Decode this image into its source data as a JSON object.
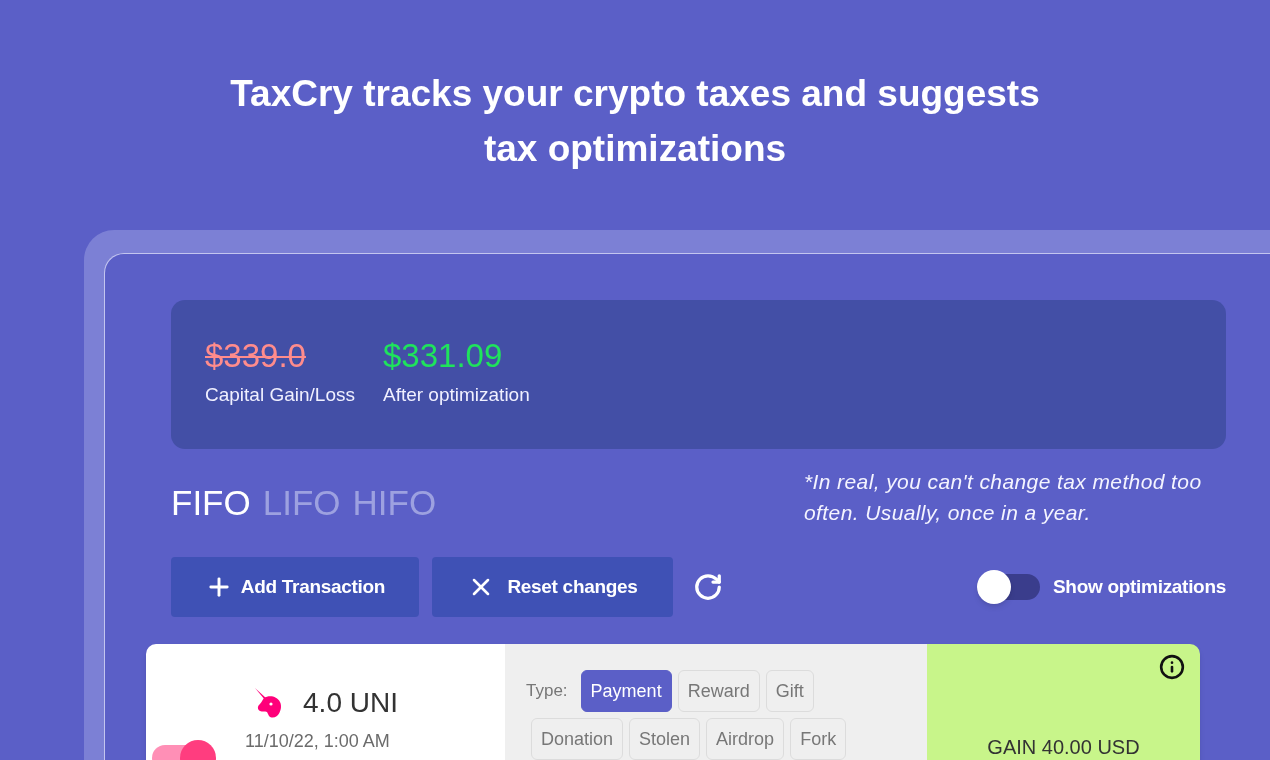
{
  "headline": "TaxCry tracks your crypto taxes and suggests tax optimizations",
  "summary": [
    {
      "kind": "original",
      "value": "$339.0",
      "label": "Capital Gain/Loss"
    },
    {
      "kind": "optimized",
      "value": "$331.09",
      "label": "After optimization"
    }
  ],
  "methods": [
    {
      "label": "FIFO",
      "selected": true
    },
    {
      "label": "LIFO",
      "selected": false
    },
    {
      "label": "HIFO",
      "selected": false
    }
  ],
  "note": "*In real, you can't change tax method too often. Usually, once in a year.",
  "actions": [
    {
      "kind": "add",
      "label": "Add Transaction"
    },
    {
      "kind": "reset",
      "label": "Reset changes"
    },
    {
      "kind": "refresh"
    }
  ],
  "optimizations_toggle": {
    "label": "Show optimizations",
    "on": false
  },
  "transaction": {
    "on": true,
    "amount": "4.0 UNI",
    "date": "11/10/22, 1:00 AM",
    "type_label": "Type:",
    "types": [
      {
        "label": "Payment",
        "selected": true
      },
      {
        "label": "Reward",
        "selected": false
      },
      {
        "label": "Gift",
        "selected": false
      },
      {
        "label": "Donation",
        "selected": false
      },
      {
        "label": "Stolen",
        "selected": false
      },
      {
        "label": "Airdrop",
        "selected": false
      },
      {
        "label": "Fork",
        "selected": false
      }
    ],
    "result": "GAIN 40.00 USD"
  }
}
